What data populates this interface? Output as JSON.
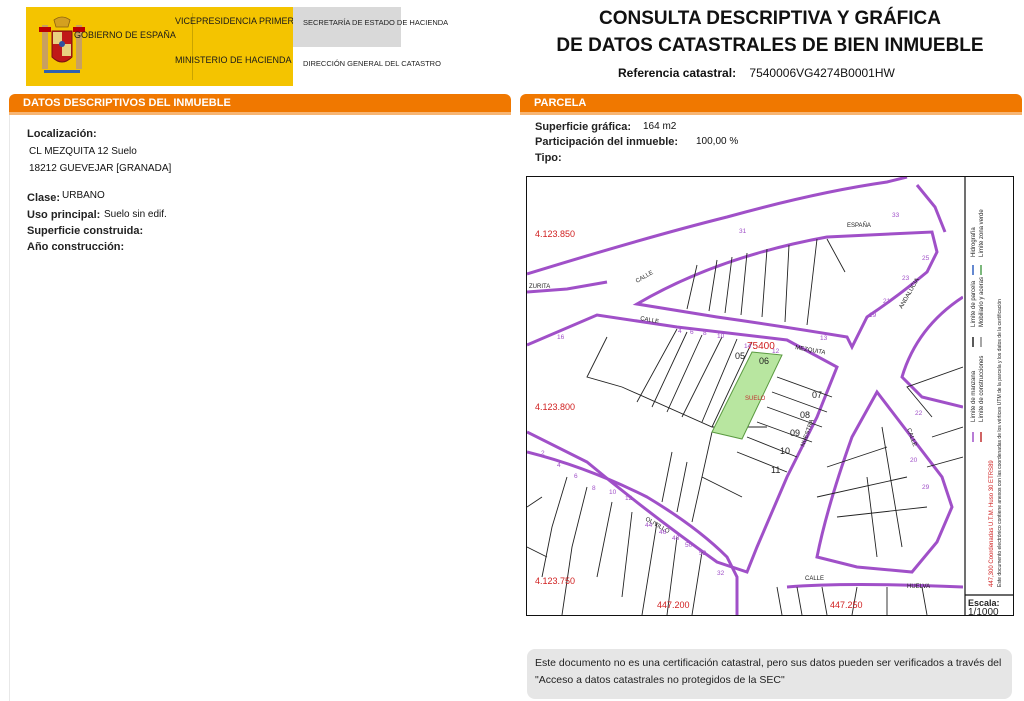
{
  "header": {
    "gov_name": "GOBIERNO\nDE ESPAÑA",
    "vicepresidencia": "VICEPRESIDENCIA\nPRIMERA DEL GOBIERNO",
    "ministerio": "MINISTERIO\nDE HACIENDA",
    "secretaria": "SECRETARÍA DE ESTADO\nDE HACIENDA",
    "direccion": "DIRECCIÓN GENERAL\nDEL CATASTRO",
    "title_line1": "CONSULTA DESCRIPTIVA Y GRÁFICA",
    "title_line2": "DE DATOS CATASTRALES DE BIEN INMUEBLE",
    "ref_label": "Referencia catastral:",
    "ref_value": "7540006VG4274B0001HW"
  },
  "descriptive": {
    "section_title": "DATOS DESCRIPTIVOS DEL INMUEBLE",
    "localizacion_label": "Localización:",
    "address_line1": "CL MEZQUITA 12 Suelo",
    "address_line2": "18212 GUEVEJAR [GRANADA]",
    "clase_label": "Clase:",
    "clase_value": "URBANO",
    "uso_label": "Uso principal:",
    "uso_value": "Suelo sin edif.",
    "superficie_label": "Superficie construida:",
    "anio_label": "Año construcción:"
  },
  "parcela": {
    "section_title": "PARCELA",
    "superficie_label": "Superficie gráfica:",
    "superficie_value": "164 m2",
    "participacion_label": "Participación del inmueble:",
    "participacion_value": "100,00 %",
    "tipo_label": "Tipo:"
  },
  "map": {
    "coords": {
      "y1": "4.123.850",
      "y2": "4.123.800",
      "y3": "4.123.750",
      "x1": "447.200",
      "x2": "447.250"
    },
    "block_id": "75400",
    "street_labels": {
      "espana": "ESPAÑA",
      "calle1": "CALLE",
      "calle2": "CALLE",
      "mezquita": "MEZQUITA",
      "andalucia": "ANDALUCIA",
      "suelo": "SUELO",
      "olivillo": "OLIVILLO",
      "calle3": "CALLE",
      "calle4": "CALLE",
      "huelva": "HUELVA",
      "nuestra": "NUESTRA",
      "zurita": "ZURITA"
    },
    "parcel_numbers": {
      "n05": "05",
      "n06": "06",
      "n07": "07",
      "n08": "08",
      "n09": "09",
      "n10": "10",
      "n11": "11",
      "n31": "31",
      "n33": "33",
      "n25": "25",
      "n23": "23",
      "n21": "21",
      "n19": "19",
      "n13": "13",
      "n14": "14",
      "n12": "12",
      "n10b": "10",
      "n8": "8",
      "n6": "6",
      "n4": "4",
      "n16": "16",
      "n2": "2",
      "n4b": "4",
      "n6b": "6",
      "n8b": "8",
      "n10c": "10",
      "n12b": "12",
      "n44": "44",
      "n46": "46",
      "n48": "48",
      "n50": "50",
      "n52": "52",
      "n22": "22",
      "n20": "20",
      "n29": "29",
      "n32": "32"
    },
    "legend": {
      "line1": "Límite de manzana",
      "line2": "Límite de parcela",
      "line3": "Límite de construcciones",
      "line4": "Mobiliario y aceras",
      "line5": "Límite zona verde",
      "line6": "Hidrografía",
      "coords_note": "447,300 Coordenadas U.T.M. Huso 30 ETRS89",
      "doc_note": "Este documento electrónico contiene anexos con las coordenadas de los vértices UTM de la parcela y los datos de la certificación"
    },
    "scale_label": "Escala:",
    "scale_value": "1/1000",
    "colors": {
      "block_line": "#a050c8",
      "parcel_fill": "#b8e6a0",
      "coord_red": "#d02020"
    }
  },
  "note": {
    "text": "Este documento no es una certificación catastral, pero sus datos pueden ser verificados a través del \"Acceso a datos catastrales no protegidos de la SEC\""
  }
}
